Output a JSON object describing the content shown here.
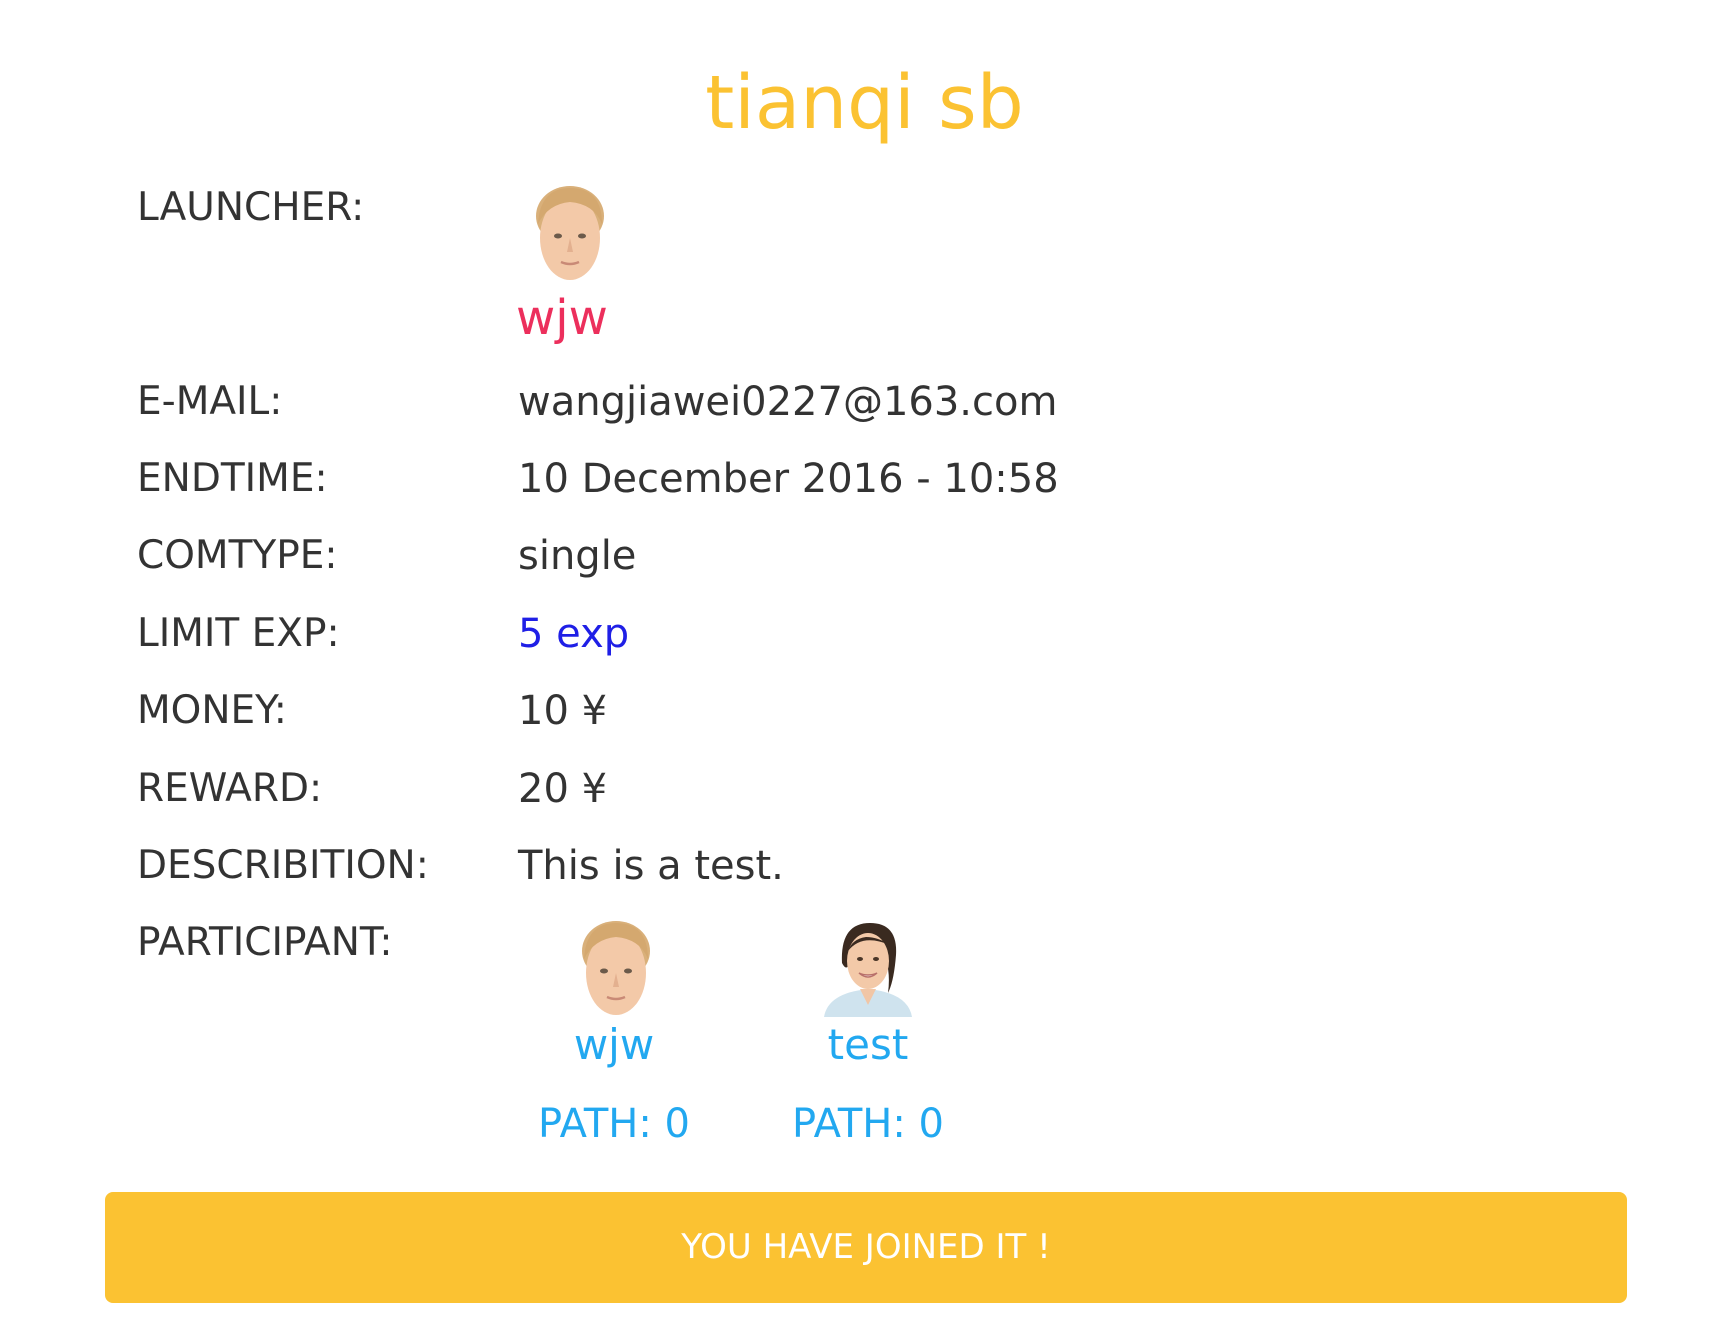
{
  "title": "tianqi sb",
  "colors": {
    "accent": "#fbc232",
    "launcher_name": "#ec2f5c",
    "participant": "#22a8f0",
    "exp_value": "#1f1fe6"
  },
  "launcher": {
    "label": "LAUNCHER:",
    "name": "wjw",
    "avatar_icon": "male-avatar-icon"
  },
  "fields": {
    "email": {
      "label": "E-MAIL:",
      "value": "wangjiawei0227@163.com"
    },
    "endtime": {
      "label": "ENDTIME:",
      "value": "10 December 2016 - 10:58"
    },
    "comtype": {
      "label": "COMTYPE:",
      "value": "single"
    },
    "limit_exp": {
      "label": "LIMIT EXP:",
      "value": "5 exp"
    },
    "money": {
      "label": "MONEY:",
      "value": "10 ¥"
    },
    "reward": {
      "label": "REWARD:",
      "value": "20 ¥"
    },
    "description": {
      "label": "DESCRIBITION:",
      "value": "This is a test."
    }
  },
  "participants_label": "PARTICIPANT:",
  "participants": [
    {
      "name": "wjw",
      "path": "PATH: 0",
      "avatar_icon": "male-avatar-icon"
    },
    {
      "name": "test",
      "path": "PATH: 0",
      "avatar_icon": "female-avatar-icon"
    }
  ],
  "join_button": {
    "label": "YOU HAVE JOINED IT !"
  }
}
